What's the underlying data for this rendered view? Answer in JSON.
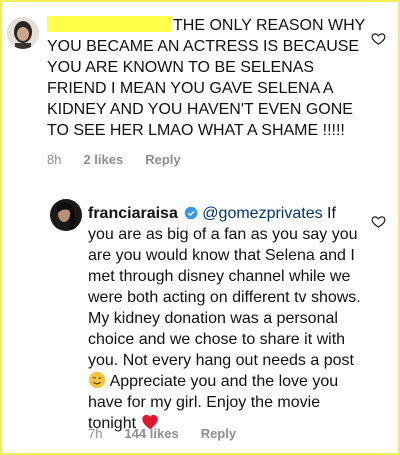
{
  "comment1": {
    "text": "THE ONLY REASON WHY YOU BECAME AN ACTRESS IS BECAUSE YOU ARE KNOWN TO BE SELENAS FRIEND I MEAN YOU GAVE SELENA A KIDNEY AND YOU HAVEN'T EVEN GONE TO SEE HER LMAO WHAT A SHAME !!!!!",
    "time": "8h",
    "likes": "2 likes",
    "reply": "Reply"
  },
  "comment2": {
    "username": "franciaraisa",
    "mention": "@gomezprivates",
    "text": "If you are as big of a fan as you say you are you would know that Selena and I met through disney channel while we were both acting on different tv shows. My kidney donation was a personal choice and we chose to share it with you. Not every hang out needs a post",
    "text2": "Appreciate you and the love you have for my girl. Enjoy the movie tonight",
    "time": "7h",
    "likes": "144 likes",
    "reply": "Reply"
  },
  "colors": {
    "highlight": "#ffff4a",
    "verified": "#3897f0",
    "heart_emoji": "#e0182d",
    "meta": "#8e8e8e"
  }
}
